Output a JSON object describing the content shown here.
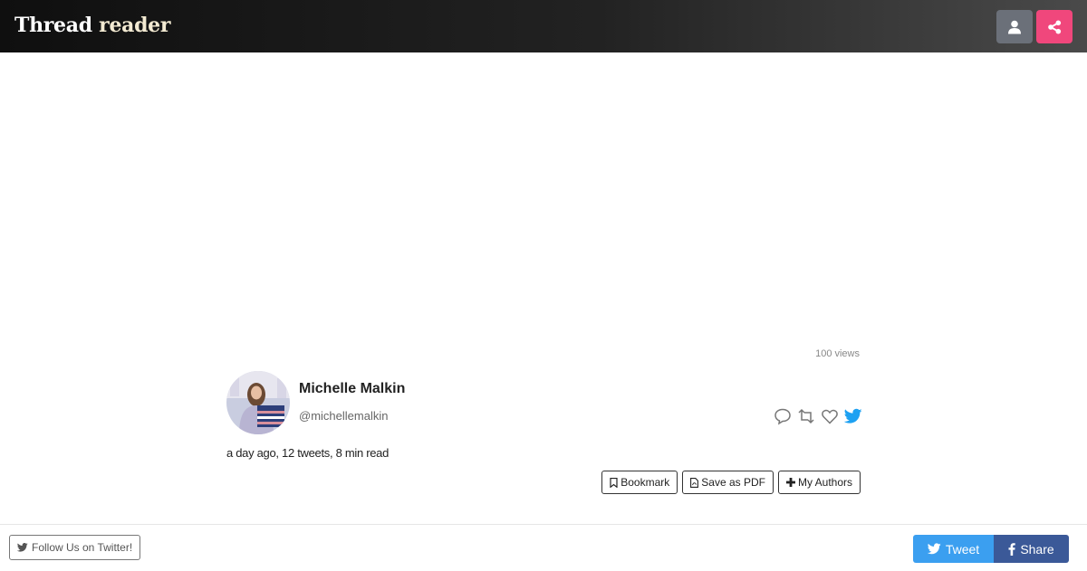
{
  "header": {
    "logo_part1": "Thread",
    "logo_part2": "reader",
    "buttons": [
      {
        "name": "user",
        "icon": "user-icon",
        "color": "#6b7079"
      },
      {
        "name": "share",
        "icon": "share-icon",
        "color": "#f0477c"
      }
    ]
  },
  "thread": {
    "views": "100 views",
    "author_name": "Michelle Malkin",
    "author_handle": "@michellemalkin",
    "meta": "a day ago, 12 tweets, 8 min read",
    "tweet_actions": [
      "reply-icon",
      "retweet-icon",
      "like-icon",
      "twitter-bird-icon"
    ]
  },
  "actions": {
    "bookmark": "Bookmark",
    "save_pdf": "Save as PDF",
    "my_authors": "My Authors"
  },
  "footer": {
    "follow": "Follow Us on Twitter!",
    "tweet": "Tweet",
    "share": "Share",
    "tweet_color": "#3b9ff0",
    "share_color": "#3b5998"
  }
}
